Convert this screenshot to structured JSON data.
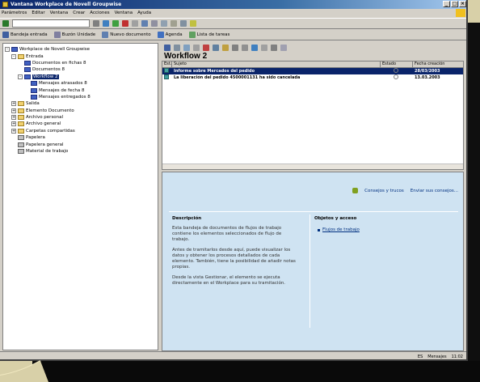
{
  "window": {
    "title": "Vantana Workplace de Novell Groupwise"
  },
  "menu": [
    "Parámetros",
    "Editar",
    "Ventana",
    "Crear",
    "Acciones",
    "Ventana",
    "Ayuda"
  ],
  "toolbar": {
    "address_value": "",
    "shortcuts": [
      "Bandeja entrada",
      "Buzón Unidade",
      "Nuevo documento",
      "Agenda",
      "Lista de tareas"
    ]
  },
  "folders": {
    "items": [
      {
        "label": "Workplace de Novell Groupwise",
        "indent": 0,
        "icon": "blue",
        "exp": "-"
      },
      {
        "label": "Entrada",
        "indent": 1,
        "icon": "yellow",
        "exp": "-"
      },
      {
        "label": "Documentos en fichas  8",
        "indent": 2,
        "icon": "blue",
        "exp": ""
      },
      {
        "label": "Documentos  8",
        "indent": 2,
        "icon": "blue",
        "exp": ""
      },
      {
        "label": "Workflow  2",
        "indent": 2,
        "icon": "blue",
        "exp": "-",
        "selected": true
      },
      {
        "label": "Mensajes atrasados  8",
        "indent": 3,
        "icon": "blue",
        "exp": ""
      },
      {
        "label": "Mensajes de fecha  8",
        "indent": 3,
        "icon": "blue",
        "exp": ""
      },
      {
        "label": "Mensajes entregados  8",
        "indent": 3,
        "icon": "blue",
        "exp": ""
      },
      {
        "label": "Salida",
        "indent": 1,
        "icon": "yellow",
        "exp": "+"
      },
      {
        "label": "Elemento Documento",
        "indent": 1,
        "icon": "yellow",
        "exp": "+"
      },
      {
        "label": "Archivo personal",
        "indent": 1,
        "icon": "yellow",
        "exp": "+"
      },
      {
        "label": "Archivo general",
        "indent": 1,
        "icon": "yellow",
        "exp": "+"
      },
      {
        "label": "Carpetas compartidas",
        "indent": 1,
        "icon": "yellow",
        "exp": "+"
      },
      {
        "label": "Papelera",
        "indent": 1,
        "icon": "grey",
        "exp": ""
      },
      {
        "label": "Papelera general",
        "indent": 1,
        "icon": "grey",
        "exp": ""
      },
      {
        "label": "Material de trabajo",
        "indent": 1,
        "icon": "grey",
        "exp": ""
      }
    ]
  },
  "main": {
    "title": "Workflow  2",
    "columns": [
      "Est.",
      "Sujeto",
      "Estado",
      "Fecha creación"
    ],
    "rows": [
      {
        "subject": "Informe sobre Mercados del pedido",
        "date": "28/03/2003",
        "selected": true
      },
      {
        "subject": "La liberación del pedido 4500001131 ha sido cancelada",
        "date": "13.03.2003",
        "selected": false
      }
    ]
  },
  "preview": {
    "link_1": "Consejos y trucos",
    "link_2": "Enviar sus consejos...",
    "desc_title": "Descripción",
    "desc_paragraphs": [
      "Esta bandeja de documentos de flujos de trabajo contiene los elementos seleccionados de flujo de trabajo.",
      "Antes de tramitarlos desde aquí, puede visualizar los datos y obtener los procesos detallados de cada elemento. También, tiene la posibilidad de añadir notas propias.",
      "Desde la vista Gestionar, el elemento se ejecuta directamente en el Workplace para su tramitación."
    ],
    "desc_bold_word": "Gestionar",
    "other_title": "Objetos y acceso",
    "other_link": "Flujos de trabajo"
  },
  "statusbar": {
    "text_1": "ES",
    "text_2": "Mensajes",
    "text_3": "11:02"
  }
}
